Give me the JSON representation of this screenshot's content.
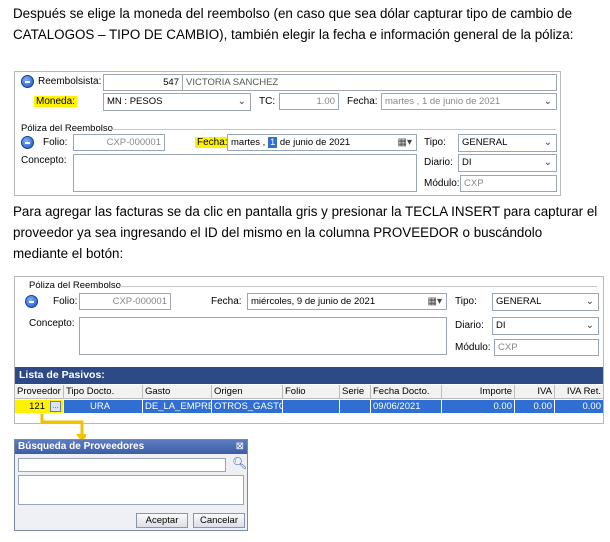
{
  "text": {
    "p1": "Después se elige la moneda del reembolso (en caso que sea dólar capturar tipo de cambio de CATALOGOS – TIPO DE CAMBIO), también elegir la fecha e información general de la póliza:",
    "p2": "Para agregar las facturas se da clic en pantalla gris y presionar la TECLA INSERT para capturar el proveedor ya sea ingresando el ID del mismo en la columna PROVEEDOR o buscándolo mediante el botón:"
  },
  "form1": {
    "reembolsista_label": "Reembolsista:",
    "reembolsista_id": "547",
    "reembolsista_name": "VICTORIA SANCHEZ",
    "moneda_label": "Moneda:",
    "moneda_value": "MN : PESOS",
    "tc_label": "TC:",
    "tc_value": "1.00",
    "fecha_label": "Fecha:",
    "fecha_value": "martes  ,  1 de    junio    de 2021",
    "poliza_group": "Póliza del Reembolso",
    "folio_label": "Folio:",
    "folio_value": "CXP-000001",
    "fecha2_label": "Fecha:",
    "fecha2_day": "martes  ,",
    "fecha2_num": "1",
    "fecha2_rest": "de    junio    de 2021",
    "tipo_label": "Tipo:",
    "tipo_value": "GENERAL",
    "concepto_label": "Concepto:",
    "diario_label": "Diario:",
    "diario_value": "DI",
    "modulo_label": "Módulo:",
    "modulo_value": "CXP"
  },
  "form2": {
    "poliza_group": "Póliza del Reembolso",
    "folio_label": "Folio:",
    "folio_value": "CXP-000001",
    "fecha_label": "Fecha:",
    "fecha_value": "miércoles,  9 de    junio    de 2021",
    "tipo_label": "Tipo:",
    "tipo_value": "GENERAL",
    "concepto_label": "Concepto:",
    "diario_label": "Diario:",
    "diario_value": "DI",
    "modulo_label": "Módulo:",
    "modulo_value": "CXP",
    "lista_title": "Lista de Pasivos:",
    "columns": [
      "Proveedor",
      "Tipo Docto.",
      "Gasto",
      "Origen",
      "Folio",
      "Serie",
      "Fecha Docto.",
      "Importe",
      "IVA",
      "IVA Ret."
    ],
    "row": {
      "proveedor": "121",
      "tipo": "FACTURA",
      "tipo_visible": "URA",
      "gasto": "DE_LA_EMPRES",
      "origen": "OTROS_GASTO",
      "folio": "",
      "serie": "",
      "fecha": "09/06/2021",
      "importe": "0.00",
      "iva": "0.00",
      "iva_ret": "0.00"
    }
  },
  "dialog": {
    "title": "Búsqueda de Proveedores",
    "accept": "Aceptar",
    "cancel": "Cancelar"
  },
  "colors": {
    "highlight": "#fff200",
    "header_bar": "#2e4a86",
    "selected_row": "#2f6ed2",
    "arrow": "#f2c200"
  }
}
